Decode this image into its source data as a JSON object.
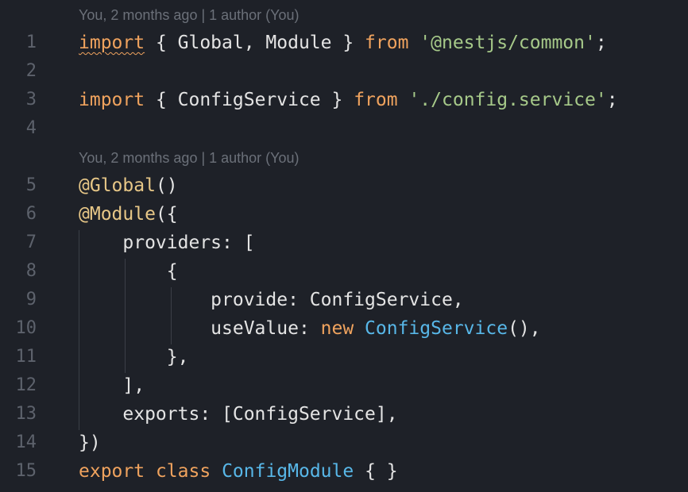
{
  "window": {
    "title": ""
  },
  "blame": {
    "top": "You, 2 months ago | 1 author (You)",
    "middle": "You, 2 months ago | 1 author (You)"
  },
  "colors": {
    "background": "#1e2128",
    "keyword": "#f0a35e",
    "string": "#a6c989",
    "class": "#58b7e8",
    "decorator": "#e7c787",
    "text": "#e4e4e4",
    "line_number": "#5d626c",
    "blame": "#6b7079"
  },
  "lines": [
    {
      "number": "1",
      "tokens": [
        {
          "text": "import",
          "type": "kw",
          "squiggle": true
        },
        {
          "text": " { Global, Module } ",
          "type": "txt"
        },
        {
          "text": "from",
          "type": "kw"
        },
        {
          "text": " ",
          "type": "txt"
        },
        {
          "text": "'@nestjs/common'",
          "type": "str"
        },
        {
          "text": ";",
          "type": "txt"
        }
      ]
    },
    {
      "number": "2",
      "tokens": []
    },
    {
      "number": "3",
      "tokens": [
        {
          "text": "import",
          "type": "kw"
        },
        {
          "text": " { ConfigService } ",
          "type": "txt"
        },
        {
          "text": "from",
          "type": "kw"
        },
        {
          "text": " ",
          "type": "txt"
        },
        {
          "text": "'./config.service'",
          "type": "str"
        },
        {
          "text": ";",
          "type": "txt"
        }
      ]
    },
    {
      "number": "4",
      "tokens": []
    },
    {
      "number": "5",
      "tokens": [
        {
          "text": "@Global",
          "type": "dec"
        },
        {
          "text": "()",
          "type": "txt"
        }
      ]
    },
    {
      "number": "6",
      "tokens": [
        {
          "text": "@Module",
          "type": "dec"
        },
        {
          "text": "({",
          "type": "txt"
        }
      ]
    },
    {
      "number": "7",
      "tokens": [
        {
          "text": "    providers: [",
          "type": "txt"
        }
      ]
    },
    {
      "number": "8",
      "tokens": [
        {
          "text": "        {",
          "type": "txt"
        }
      ]
    },
    {
      "number": "9",
      "tokens": [
        {
          "text": "            provide: ConfigService,",
          "type": "txt"
        }
      ]
    },
    {
      "number": "10",
      "tokens": [
        {
          "text": "            useValue: ",
          "type": "txt"
        },
        {
          "text": "new",
          "type": "kw"
        },
        {
          "text": " ",
          "type": "txt"
        },
        {
          "text": "ConfigService",
          "type": "cls"
        },
        {
          "text": "(),",
          "type": "txt"
        }
      ]
    },
    {
      "number": "11",
      "tokens": [
        {
          "text": "        },",
          "type": "txt"
        }
      ]
    },
    {
      "number": "12",
      "tokens": [
        {
          "text": "    ],",
          "type": "txt"
        }
      ]
    },
    {
      "number": "13",
      "tokens": [
        {
          "text": "    exports: [ConfigService],",
          "type": "txt"
        }
      ]
    },
    {
      "number": "14",
      "tokens": [
        {
          "text": "})",
          "type": "txt"
        }
      ]
    },
    {
      "number": "15",
      "tokens": [
        {
          "text": "export",
          "type": "kw"
        },
        {
          "text": " ",
          "type": "txt"
        },
        {
          "text": "class",
          "type": "kw"
        },
        {
          "text": " ",
          "type": "txt"
        },
        {
          "text": "ConfigModule",
          "type": "cls"
        },
        {
          "text": " { }",
          "type": "txt"
        }
      ]
    }
  ]
}
